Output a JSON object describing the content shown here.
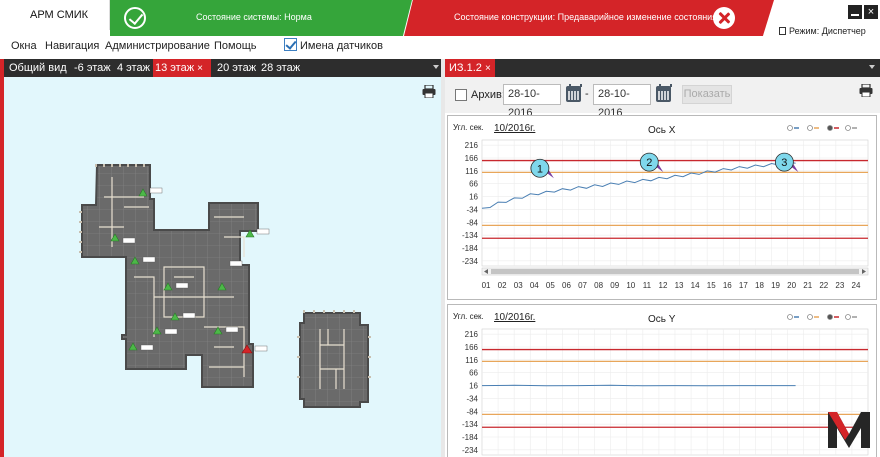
{
  "titlebar": {
    "app_title": "АРМ СМИК",
    "system_status": "Состояние системы: Норма",
    "construction_status": "Состояние конструкции: Предаварийное изменение состояния",
    "mode_label": "Режим: Диспетчер",
    "colors": {
      "ok": "#35a53a",
      "alarm": "#d42428"
    }
  },
  "menu": {
    "items": [
      "Окна",
      "Навигация",
      "Администрирование",
      "Помощь"
    ],
    "sensor_names_label": "Имена датчиков",
    "sensor_names_checked": true
  },
  "floor_tabs": [
    "Общий вид",
    "-6 этаж",
    "4 этаж",
    "13 этаж",
    "20 этаж",
    "28 этаж"
  ],
  "active_floor_tab": "13 этаж",
  "right_tab": {
    "label": "ИЗ.1.2"
  },
  "toolbar": {
    "archive_label": "Архив:",
    "archive_checked": false,
    "date_from": "28-10-2016",
    "dash": "-",
    "date_to": "28-10-2016",
    "show_button": "Показать"
  },
  "chart_data": [
    {
      "type": "line",
      "title": "Ось X",
      "ylabel": "Угл. сек.",
      "period": "10/2016г.",
      "yticks": [
        216,
        166,
        116,
        66,
        16,
        -34,
        -84,
        -134,
        -184,
        -234
      ],
      "xticks": [
        "01",
        "02",
        "03",
        "04",
        "05",
        "06",
        "07",
        "08",
        "09",
        "10",
        "11",
        "12",
        "13",
        "14",
        "15",
        "16",
        "17",
        "18",
        "19",
        "20",
        "21",
        "22",
        "23",
        "24"
      ],
      "ylim": [
        -254,
        236
      ],
      "xlim": [
        0,
        24
      ],
      "thresholds": [
        {
          "value": 156,
          "color": "#c8282e"
        },
        {
          "value": 110,
          "color": "#e8a65a"
        },
        {
          "value": -96,
          "color": "#e8a65a"
        },
        {
          "value": -146,
          "color": "#c8282e"
        }
      ],
      "series": [
        {
          "color": "#4a7fb3",
          "x": [
            0.0,
            0.5,
            1.0,
            1.5,
            2.0,
            2.5,
            3.0,
            3.5,
            4.0,
            4.5,
            5.0,
            5.5,
            6.0,
            6.5,
            7.0,
            7.5,
            8.0,
            8.5,
            9.0,
            9.5,
            10.0,
            10.5,
            11.0,
            11.5,
            12.0,
            12.5,
            13.0,
            13.5,
            14.0,
            14.5,
            15.0,
            15.5,
            16.0,
            16.5,
            17.0,
            17.5,
            18.0,
            18.5,
            19.0,
            19.5
          ],
          "y": [
            -34,
            -22,
            -10,
            -2,
            6,
            14,
            22,
            28,
            32,
            38,
            42,
            46,
            50,
            53,
            57,
            60,
            64,
            68,
            72,
            75,
            78,
            82,
            86,
            90,
            94,
            98,
            103,
            107,
            111,
            116,
            120,
            124,
            128,
            131,
            134,
            137,
            140,
            143,
            146,
            150
          ]
        }
      ],
      "markers": [
        {
          "label": "1",
          "x": 3.6,
          "y": 126
        },
        {
          "label": "2",
          "x": 10.4,
          "y": 150
        },
        {
          "label": "3",
          "x": 18.8,
          "y": 150
        }
      ],
      "legend": "top-right",
      "scrollbar": true
    },
    {
      "type": "line",
      "title": "Ось Y",
      "ylabel": "Угл. сек.",
      "period": "10/2016г.",
      "yticks": [
        216,
        166,
        116,
        66,
        16,
        -34,
        -84,
        -134,
        -184,
        -234
      ],
      "ylim": [
        -254,
        236
      ],
      "xlim": [
        0,
        24
      ],
      "thresholds": [
        {
          "value": 156,
          "color": "#c8282e"
        },
        {
          "value": 110,
          "color": "#e8a65a"
        },
        {
          "value": -96,
          "color": "#e8a65a"
        },
        {
          "value": -146,
          "color": "#c8282e"
        }
      ],
      "series": [
        {
          "color": "#4a7fb3",
          "x": [
            0,
            2,
            4,
            6,
            8,
            10,
            12,
            14,
            16,
            18,
            19.5
          ],
          "y": [
            16,
            17,
            15,
            16,
            17,
            15,
            16,
            15,
            16,
            16,
            16
          ]
        }
      ],
      "legend": "top-right"
    }
  ]
}
